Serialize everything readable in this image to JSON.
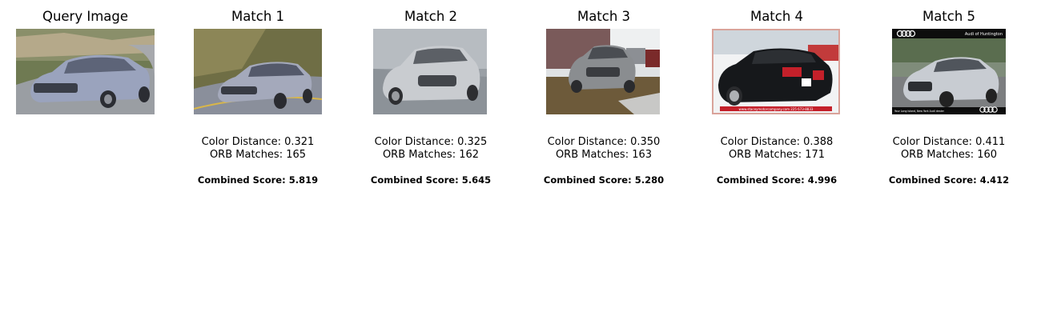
{
  "query": {
    "title": "Query Image",
    "image_subject": "silver sedan on a winding road"
  },
  "matches": [
    {
      "title": "Match 1",
      "image_subject": "silver sedan on road",
      "color_distance_label": "Color Distance: 0.321",
      "orb_matches_label": "ORB Matches: 165",
      "combined_score_label": "Combined Score: 5.819",
      "color_distance": 0.321,
      "orb_matches": 165,
      "combined_score": 5.819
    },
    {
      "title": "Match 2",
      "image_subject": "silver sedan in studio",
      "color_distance_label": "Color Distance: 0.325",
      "orb_matches_label": "ORB Matches: 162",
      "combined_score_label": "Combined Score: 5.645",
      "color_distance": 0.325,
      "orb_matches": 162,
      "combined_score": 5.645
    },
    {
      "title": "Match 3",
      "image_subject": "grey SUV in parking lot",
      "color_distance_label": "Color Distance: 0.350",
      "orb_matches_label": "ORB Matches: 163",
      "combined_score_label": "Combined Score: 5.280",
      "color_distance": 0.35,
      "orb_matches": 163,
      "combined_score": 5.28
    },
    {
      "title": "Match 4",
      "image_subject": "black convertible at dealership",
      "banner_text": "www.staceymotorcompany.com   225 673-8833",
      "color_distance_label": "Color Distance: 0.388",
      "orb_matches_label": "ORB Matches: 171",
      "combined_score_label": "Combined Score: 4.996",
      "color_distance": 0.388,
      "orb_matches": 171,
      "combined_score": 4.996
    },
    {
      "title": "Match 5",
      "image_subject": "silver Audi sedan at dealership",
      "dealer_text": "Audi of Huntington",
      "footer_text": "Your Long Island, New York Audi dealer",
      "color_distance_label": "Color Distance: 0.411",
      "orb_matches_label": "ORB Matches: 160",
      "combined_score_label": "Combined Score: 4.412",
      "color_distance": 0.411,
      "orb_matches": 160,
      "combined_score": 4.412
    }
  ]
}
